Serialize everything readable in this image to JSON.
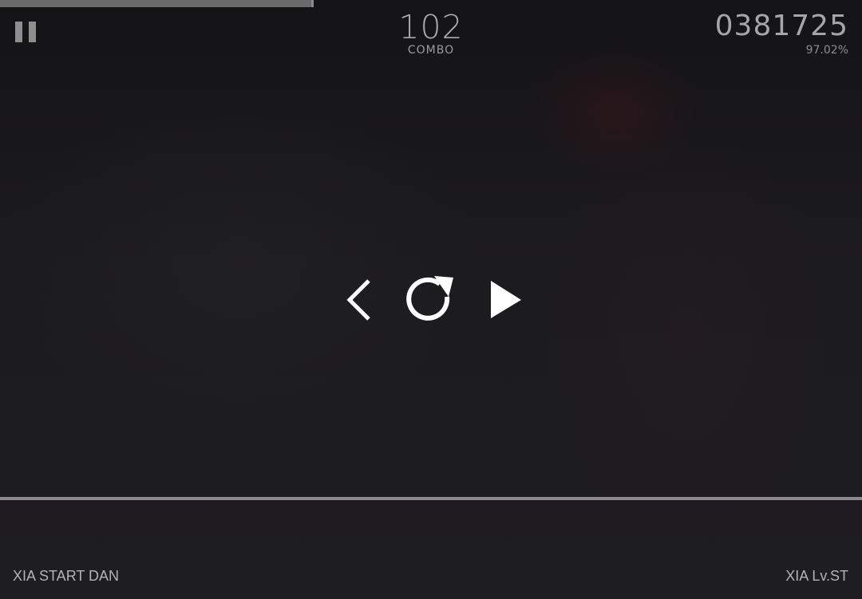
{
  "hud": {
    "progress": 0.364,
    "combo": "102",
    "combo_label": "COMBO",
    "score": "0381725",
    "accuracy": "97.02%"
  },
  "icons": {
    "pause": "pause-icon",
    "back": "chevron-left-icon",
    "retry": "retry-icon",
    "resume": "play-icon"
  },
  "song": {
    "title": "XIA START DAN",
    "level": "XIA Lv.ST"
  },
  "colors": {
    "background": "#1b1a1c",
    "hud_text": "#a9a9a9",
    "judge_line": "#8a8a8a",
    "icon_white": "#ffffff"
  }
}
